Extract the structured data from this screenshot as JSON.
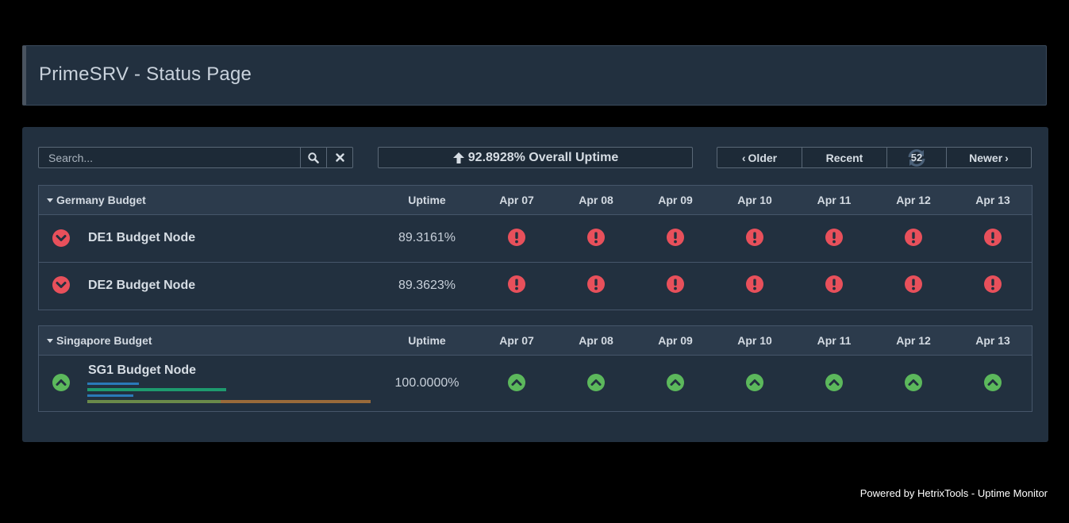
{
  "page": {
    "title": "PrimeSRV - Status Page",
    "footer": "Powered by HetrixTools - Uptime Monitor"
  },
  "toolbar": {
    "search_placeholder": "Search...",
    "overall_uptime": "92.8928% Overall Uptime",
    "older_label": "Older",
    "recent_label": "Recent",
    "refresh_count": "52",
    "newer_label": "Newer"
  },
  "columns": {
    "uptime": "Uptime",
    "days": [
      "Apr 07",
      "Apr 08",
      "Apr 09",
      "Apr 10",
      "Apr 11",
      "Apr 12",
      "Apr 13"
    ]
  },
  "groups": [
    {
      "name": "Germany Budget",
      "monitors": [
        {
          "name": "DE1 Budget Node",
          "uptime": "89.3161%",
          "status": "down",
          "days": [
            "down",
            "down",
            "down",
            "down",
            "down",
            "down",
            "down"
          ]
        },
        {
          "name": "DE2 Budget Node",
          "uptime": "89.3623%",
          "status": "down",
          "days": [
            "down",
            "down",
            "down",
            "down",
            "down",
            "down",
            "down"
          ]
        }
      ]
    },
    {
      "name": "Singapore Budget",
      "monitors": [
        {
          "name": "SG1 Budget Node",
          "uptime": "100.0000%",
          "status": "up",
          "days": [
            "up",
            "up",
            "up",
            "up",
            "up",
            "up",
            "up"
          ]
        }
      ]
    }
  ],
  "colors": {
    "down": "#e8505b",
    "up": "#5cb85c",
    "bar_blue": "#2a7ab8",
    "bar_green": "#1e9a6e",
    "bar_olive": "#6a8a4a",
    "bar_orange": "#9a6a3a"
  },
  "icons": {
    "search": "search-icon",
    "clear": "close-icon",
    "overall": "arrow-up-icon",
    "refresh": "refresh-icon",
    "down_row": "chevron-down-circle-icon",
    "up_row": "chevron-up-circle-icon",
    "day_down": "exclamation-circle-icon",
    "day_up": "chevron-up-circle-icon"
  }
}
